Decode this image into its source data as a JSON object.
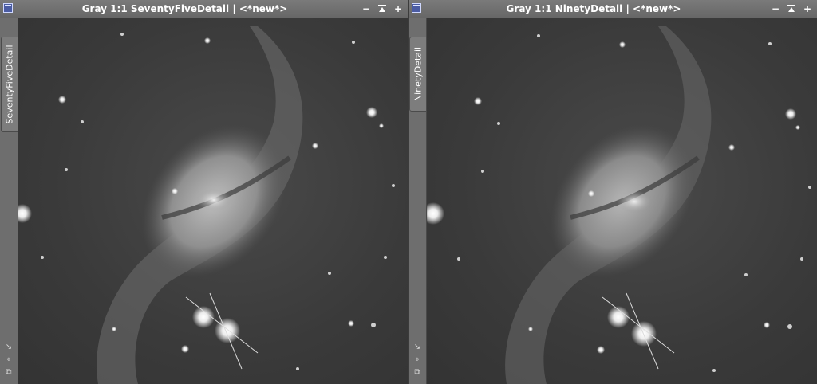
{
  "windows": [
    {
      "title": "Gray 1:1 SeventyFiveDetail | <*new*>",
      "side_tab": "SeventyFiveDetail"
    },
    {
      "title": "Gray 1:1 NinetyDetail | <*new*>",
      "side_tab": "NinetyDetail"
    }
  ],
  "controls": {
    "minimize_glyph": "−",
    "add_glyph": "+"
  },
  "sidebar_tools": [
    "↘",
    "⌖",
    "⧉"
  ]
}
